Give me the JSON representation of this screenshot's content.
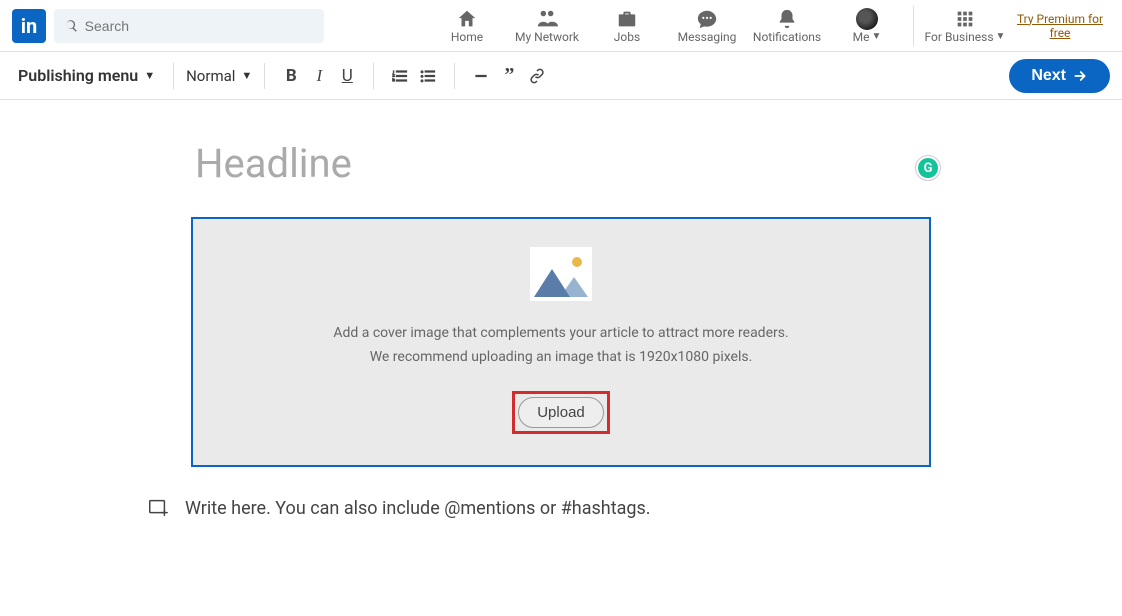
{
  "header": {
    "logo_text": "in",
    "search_placeholder": "Search",
    "nav": {
      "home": "Home",
      "network": "My Network",
      "jobs": "Jobs",
      "messaging": "Messaging",
      "notifications": "Notifications",
      "me": "Me",
      "business": "For Business"
    },
    "premium_link": "Try Premium for free"
  },
  "toolbar": {
    "publishing_menu": "Publishing menu",
    "style_select": "Normal",
    "next_button": "Next"
  },
  "editor": {
    "headline_placeholder": "Headline",
    "cover_instruction_1": "Add a cover image that complements your article to attract more readers.",
    "cover_instruction_2": "We recommend uploading an image that is 1920x1080 pixels.",
    "upload_button": "Upload",
    "body_placeholder": "Write here. You can also include @mentions or #hashtags.",
    "grammarly_letter": "G"
  }
}
